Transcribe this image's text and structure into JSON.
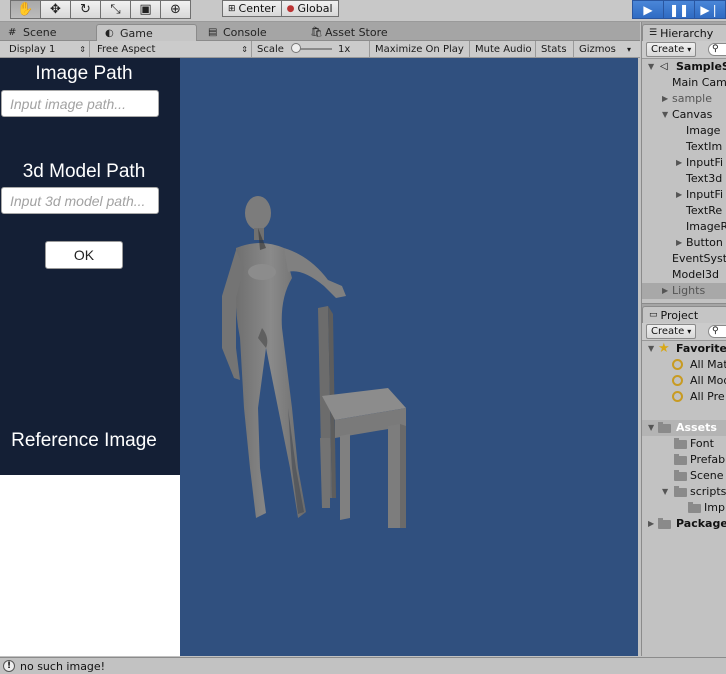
{
  "toolbar": {
    "tools": [
      "hand-icon",
      "move-icon",
      "rotate-icon",
      "scale-icon",
      "rect-tool-icon",
      "transform-icon"
    ],
    "pivot_center": "Center",
    "pivot_global": "Global"
  },
  "game_panel": {
    "tabs": [
      "Scene",
      "Game",
      "Console",
      "Asset Store"
    ],
    "display": "Display 1",
    "aspect": "Free Aspect",
    "scale_label": "Scale",
    "scale_value": "1x",
    "maximize": "Maximize On Play",
    "mute": "Mute Audio",
    "stats": "Stats",
    "gizmos": "Gizmos"
  },
  "game_view": {
    "image_path_label": "Image Path",
    "image_path_placeholder": "Input image path...",
    "model_path_label": "3d Model Path",
    "model_path_placeholder": "Input 3d model path...",
    "ok_button": "OK",
    "reference_label": "Reference Image",
    "colors": {
      "viewport_bg": "#30507f",
      "panel_bg": "#141f35"
    }
  },
  "hierarchy": {
    "tab": "Hierarchy",
    "create": "Create",
    "items": [
      {
        "label": "SampleS",
        "bold": true
      },
      {
        "label": "Main Cam"
      },
      {
        "label": "sample"
      },
      {
        "label": "Canvas"
      },
      {
        "label": "Image"
      },
      {
        "label": "TextIm"
      },
      {
        "label": "InputFi"
      },
      {
        "label": "Text3d"
      },
      {
        "label": "InputFi"
      },
      {
        "label": "TextRe"
      },
      {
        "label": "ImageR"
      },
      {
        "label": "Button"
      },
      {
        "label": "EventSyst"
      },
      {
        "label": "Model3d"
      },
      {
        "label": "Lights"
      }
    ]
  },
  "project": {
    "tab": "Project",
    "create": "Create",
    "favorites": "Favorite",
    "fav_items": [
      "All Mat",
      "All Mod",
      "All Pre"
    ],
    "assets": "Assets",
    "asset_items": [
      "Font",
      "Prefab",
      "Scene",
      "scripts",
      "Imp"
    ],
    "packages": "Package"
  },
  "status": {
    "message": "no such image!"
  }
}
